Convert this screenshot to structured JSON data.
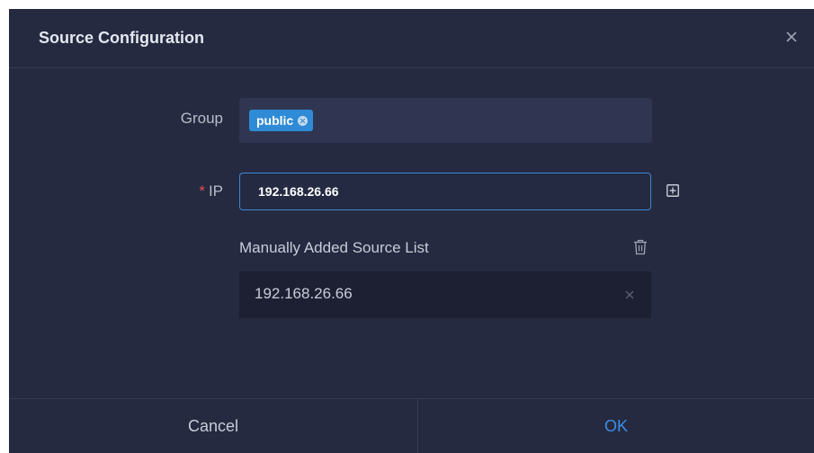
{
  "dialog": {
    "title": "Source Configuration",
    "close_icon": "close-icon"
  },
  "form": {
    "group_label": "Group",
    "group_tags": [
      "public"
    ],
    "ip_required_mark": "*",
    "ip_label": "IP",
    "ip_value": "192.168.26.66",
    "add_icon": "plus-square-icon"
  },
  "source_list": {
    "title": "Manually Added Source List",
    "clear_icon": "trash-icon",
    "items": [
      "192.168.26.66"
    ],
    "remove_icon": "close-icon"
  },
  "footer": {
    "cancel_label": "Cancel",
    "ok_label": "OK"
  },
  "colors": {
    "dialog_bg": "#252a40",
    "accent": "#3c8ee6",
    "tag_bg": "#2f8bd6",
    "required": "#e0504d"
  }
}
